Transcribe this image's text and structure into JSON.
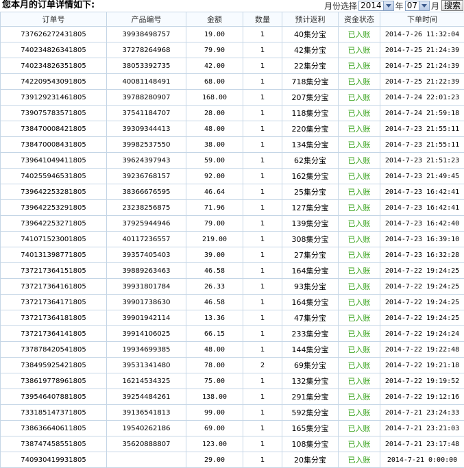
{
  "header": {
    "title": "您本月的订单详情如下:",
    "month_select_label": "月份选择",
    "year_value": "2014",
    "year_unit": "年",
    "month_value": "07",
    "month_unit": "月",
    "search_label": "搜索"
  },
  "columns": [
    "订单号",
    "产品编号",
    "金额",
    "数量",
    "预计返利",
    "资金状态",
    "下单时间"
  ],
  "rows": [
    [
      "737626272431805",
      "39938498757",
      "19.00",
      "1",
      "40集分宝",
      "已入账",
      "2014-7-26 11:32:04"
    ],
    [
      "740234826341805",
      "37278264968",
      "79.90",
      "1",
      "42集分宝",
      "已入账",
      "2014-7-25 21:24:39"
    ],
    [
      "740234826351805",
      "38053392735",
      "42.00",
      "1",
      "22集分宝",
      "已入账",
      "2014-7-25 21:24:39"
    ],
    [
      "742209543091805",
      "40081148491",
      "68.00",
      "1",
      "718集分宝",
      "已入账",
      "2014-7-25 21:22:39"
    ],
    [
      "739129231461805",
      "39788280907",
      "168.00",
      "1",
      "207集分宝",
      "已入账",
      "2014-7-24 22:01:23"
    ],
    [
      "739075783571805",
      "37541184707",
      "28.00",
      "1",
      "118集分宝",
      "已入账",
      "2014-7-24 21:59:18"
    ],
    [
      "738470008421805",
      "39309344413",
      "48.00",
      "1",
      "220集分宝",
      "已入账",
      "2014-7-23 21:55:11"
    ],
    [
      "738470008431805",
      "39982537550",
      "38.00",
      "1",
      "134集分宝",
      "已入账",
      "2014-7-23 21:55:11"
    ],
    [
      "739641049411805",
      "39624397943",
      "59.00",
      "1",
      "62集分宝",
      "已入账",
      "2014-7-23 21:51:23"
    ],
    [
      "740255946531805",
      "39236768157",
      "92.00",
      "1",
      "162集分宝",
      "已入账",
      "2014-7-23 21:49:45"
    ],
    [
      "739642253281805",
      "38366676595",
      "46.64",
      "1",
      "25集分宝",
      "已入账",
      "2014-7-23 16:42:41"
    ],
    [
      "739642253291805",
      "23238256875",
      "71.96",
      "1",
      "127集分宝",
      "已入账",
      "2014-7-23 16:42:41"
    ],
    [
      "739642253271805",
      "37925944946",
      "79.00",
      "1",
      "139集分宝",
      "已入账",
      "2014-7-23 16:42:40"
    ],
    [
      "741071523001805",
      "40117236557",
      "219.00",
      "1",
      "308集分宝",
      "已入账",
      "2014-7-23 16:39:10"
    ],
    [
      "740131398771805",
      "39357405403",
      "39.00",
      "1",
      "27集分宝",
      "已入账",
      "2014-7-23 16:32:28"
    ],
    [
      "737217364151805",
      "39889263463",
      "46.58",
      "1",
      "164集分宝",
      "已入账",
      "2014-7-22 19:24:25"
    ],
    [
      "737217364161805",
      "39931801784",
      "26.33",
      "1",
      "93集分宝",
      "已入账",
      "2014-7-22 19:24:25"
    ],
    [
      "737217364171805",
      "39901738630",
      "46.58",
      "1",
      "164集分宝",
      "已入账",
      "2014-7-22 19:24:25"
    ],
    [
      "737217364181805",
      "39901942114",
      "13.36",
      "1",
      "47集分宝",
      "已入账",
      "2014-7-22 19:24:25"
    ],
    [
      "737217364141805",
      "39914106025",
      "66.15",
      "1",
      "233集分宝",
      "已入账",
      "2014-7-22 19:24:24"
    ],
    [
      "737878420541805",
      "19934699385",
      "48.00",
      "1",
      "144集分宝",
      "已入账",
      "2014-7-22 19:22:48"
    ],
    [
      "738495925421805",
      "39531341480",
      "78.00",
      "2",
      "69集分宝",
      "已入账",
      "2014-7-22 19:21:18"
    ],
    [
      "738619778961805",
      "16214534325",
      "75.00",
      "1",
      "132集分宝",
      "已入账",
      "2014-7-22 19:19:52"
    ],
    [
      "739546407881805",
      "39254484261",
      "138.00",
      "1",
      "291集分宝",
      "已入账",
      "2014-7-22 19:12:16"
    ],
    [
      "733185147371805",
      "39136541813",
      "99.00",
      "1",
      "592集分宝",
      "已入账",
      "2014-7-21 23:24:33"
    ],
    [
      "738636640611805",
      "19540262186",
      "69.00",
      "1",
      "165集分宝",
      "已入账",
      "2014-7-21 23:21:03"
    ],
    [
      "738747458551805",
      "35620888807",
      "123.00",
      "1",
      "108集分宝",
      "已入账",
      "2014-7-21 23:17:48"
    ],
    [
      "740930419931805",
      "",
      "29.00",
      "1",
      "20集分宝",
      "已入账",
      "2014-7-21 0:00:00"
    ]
  ],
  "colors": {
    "status_green": "#2e9e11",
    "border": "#c5d6e6"
  }
}
